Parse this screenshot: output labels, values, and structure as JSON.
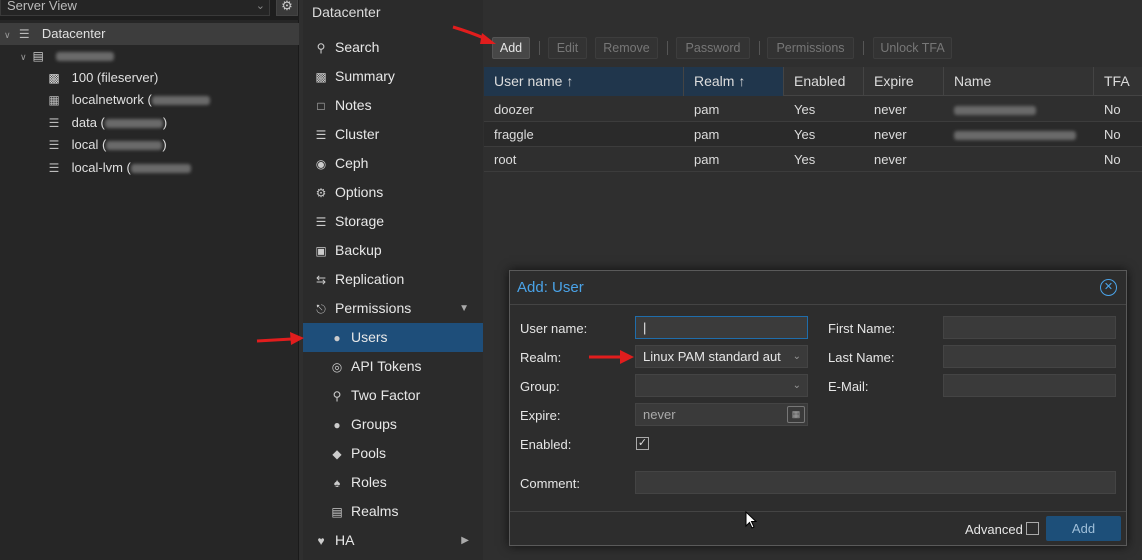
{
  "tree": {
    "view_label": "Server View",
    "datacenter": "Datacenter",
    "items": [
      {
        "label": "100 (fileserver)"
      },
      {
        "label": "localnetwork ("
      },
      {
        "label": "data ("
      },
      {
        "label": "local ("
      },
      {
        "label": "local-lvm ("
      }
    ],
    "close_paren": ")"
  },
  "nav": {
    "title": "Datacenter",
    "items": [
      {
        "label": "Search",
        "icon": "search-icon"
      },
      {
        "label": "Summary",
        "icon": "book-icon"
      },
      {
        "label": "Notes",
        "icon": "notes-icon"
      },
      {
        "label": "Cluster",
        "icon": "server-icon"
      },
      {
        "label": "Ceph",
        "icon": "ceph-icon"
      },
      {
        "label": "Options",
        "icon": "gear-icon"
      },
      {
        "label": "Storage",
        "icon": "database-icon"
      },
      {
        "label": "Backup",
        "icon": "floppy-icon"
      },
      {
        "label": "Replication",
        "icon": "retweet-icon"
      },
      {
        "label": "Permissions",
        "icon": "unlock-icon"
      },
      {
        "label": "Users",
        "icon": "user-icon"
      },
      {
        "label": "API Tokens",
        "icon": "lock-icon"
      },
      {
        "label": "Two Factor",
        "icon": "key-icon"
      },
      {
        "label": "Groups",
        "icon": "users-icon"
      },
      {
        "label": "Pools",
        "icon": "tags-icon"
      },
      {
        "label": "Roles",
        "icon": "male-icon"
      },
      {
        "label": "Realms",
        "icon": "address-book-icon"
      },
      {
        "label": "HA",
        "icon": "heartbeat-icon"
      }
    ]
  },
  "toolbar": {
    "add": "Add",
    "edit": "Edit",
    "remove": "Remove",
    "password": "Password",
    "permissions": "Permissions",
    "unlock_tfa": "Unlock TFA"
  },
  "grid": {
    "columns": [
      "User name ↑",
      "Realm ↑",
      "Enabled",
      "Expire",
      "Name",
      "TFA"
    ],
    "rows": [
      {
        "user": "doozer",
        "realm": "pam",
        "enabled": "Yes",
        "expire": "never",
        "tfa": "No"
      },
      {
        "user": "fraggle",
        "realm": "pam",
        "enabled": "Yes",
        "expire": "never",
        "tfa": "No"
      },
      {
        "user": "root",
        "realm": "pam",
        "enabled": "Yes",
        "expire": "never",
        "tfa": "No"
      }
    ]
  },
  "dialog": {
    "title": "Add: User",
    "labels": {
      "username": "User name:",
      "realm": "Realm:",
      "group": "Group:",
      "expire": "Expire:",
      "enabled": "Enabled:",
      "comment": "Comment:",
      "first_name": "First Name:",
      "last_name": "Last Name:",
      "email": "E-Mail:"
    },
    "values": {
      "username": "|",
      "realm": "Linux PAM standard aut",
      "group": "",
      "expire": "never",
      "comment": ""
    },
    "enabled_checked": true,
    "advanced_label": "Advanced",
    "advanced_checked": false,
    "submit": "Add"
  },
  "colors": {
    "accent": "#4aa3e8",
    "selected": "#1e4e7a",
    "arrow": "#e11d1d"
  }
}
